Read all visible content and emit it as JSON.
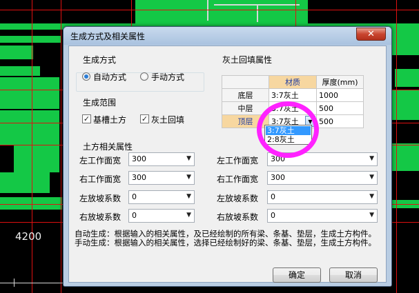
{
  "background": {
    "dimension_label": "4200"
  },
  "dialog": {
    "title": "生成方式及相关属性",
    "close_symbol": "✕",
    "generation_method": {
      "label": "生成方式",
      "auto": "自动方式",
      "manual": "手动方式",
      "selected": "auto"
    },
    "generation_scope": {
      "label": "生成范围",
      "foundation_earthwork": "基槽土方",
      "lime_soil_backfill": "灰土回填",
      "foundation_earthwork_checked": true,
      "lime_soil_backfill_checked": true
    },
    "earthwork_props": {
      "label": "土方相关属性",
      "rows": [
        {
          "label": "左工作面宽",
          "value": "300"
        },
        {
          "label": "右工作面宽",
          "value": "300"
        },
        {
          "label": "左放坡系数",
          "value": "0"
        },
        {
          "label": "右放坡系数",
          "value": "0"
        }
      ]
    },
    "backfill_props": {
      "label": "灰土回填属性",
      "col_material": "材质",
      "col_thickness": "厚度(mm)",
      "rows": [
        {
          "layer": "底层",
          "material": "3:7灰土",
          "thickness": "1000"
        },
        {
          "layer": "中层",
          "material": "3:7灰土",
          "thickness": "500"
        },
        {
          "layer": "顶层",
          "material": "3:7灰土",
          "thickness": "500"
        }
      ],
      "dropdown_options": [
        "3:7灰土",
        "2:8灰土"
      ]
    },
    "right_props": {
      "rows": [
        {
          "label": "左工作面宽",
          "value": "300"
        },
        {
          "label": "右工作面宽",
          "value": "300"
        },
        {
          "label": "左放坡系数",
          "value": "0"
        },
        {
          "label": "右放坡系数",
          "value": "0"
        }
      ]
    },
    "notes": {
      "auto": "自动生成：根据输入的相关属性，及已经绘制的所有梁、条基、垫层，生成土方构件。",
      "manual": "手动生成：根据输入的相关属性，选择已经绘制好的梁、条基、垫层，生成土方构件。"
    },
    "ok_label": "确定",
    "cancel_label": "取消"
  },
  "colors": {
    "cad_green": "#14c846",
    "cad_red": "#e01010",
    "highlight_ring": "#ff22ff",
    "selection_blue": "#3399ff"
  }
}
